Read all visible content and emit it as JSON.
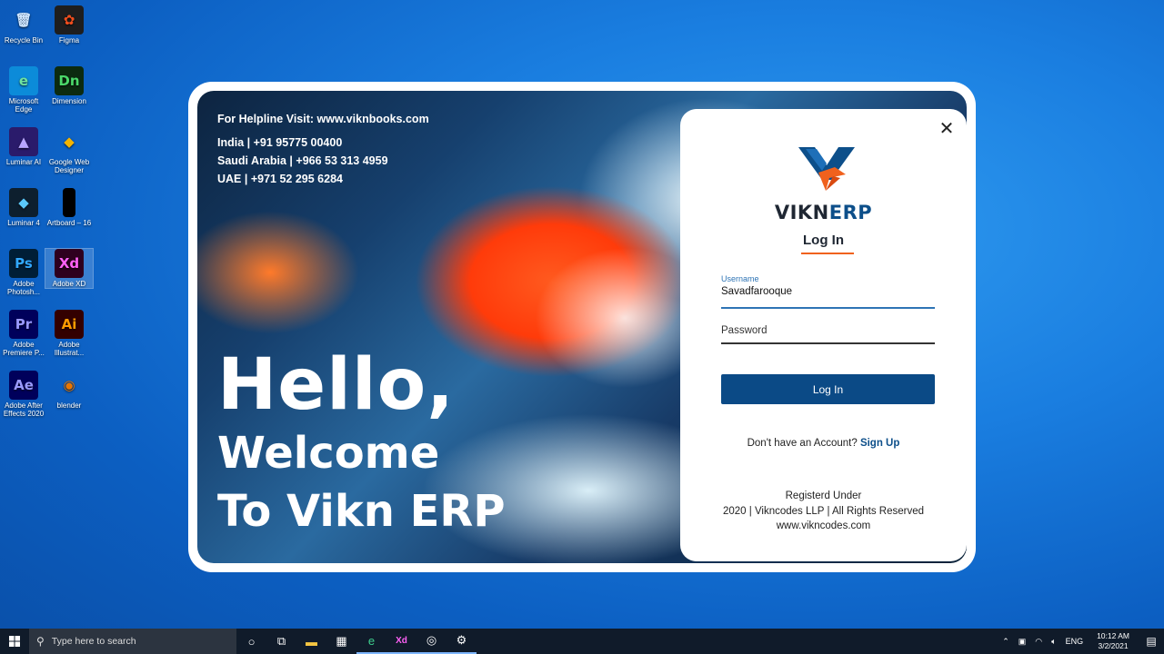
{
  "desktop": {
    "icons": [
      {
        "label": "Recycle Bin",
        "icon": "recycle-bin-icon",
        "glyph": "🗑",
        "bg": "transparent",
        "fg": "#cfe6ff"
      },
      {
        "label": "Figma",
        "icon": "figma-icon",
        "glyph": "✿",
        "bg": "#1e1e1e",
        "fg": "#f24e1e"
      },
      {
        "label": "Microsoft Edge",
        "icon": "edge-icon",
        "glyph": "e",
        "bg": "#0c8bd9",
        "fg": "#6fe3a0"
      },
      {
        "label": "Dimension",
        "icon": "dimension-icon",
        "glyph": "Dn",
        "bg": "#0c2b10",
        "fg": "#4bd96a"
      },
      {
        "label": "Luminar AI",
        "icon": "luminar-ai-icon",
        "glyph": "▲",
        "bg": "#2a1b6b",
        "fg": "#b8a6ff"
      },
      {
        "label": "Google Web Designer",
        "icon": "google-web-designer-icon",
        "glyph": "◆",
        "bg": "transparent",
        "fg": "#f4b400"
      },
      {
        "label": "Luminar 4",
        "icon": "luminar-4-icon",
        "glyph": "◆",
        "bg": "#0d1f2e",
        "fg": "#5ac8fa"
      },
      {
        "label": "Artboard – 16",
        "icon": "artboard-icon",
        "glyph": "",
        "bg": "#000000",
        "fg": "#000000"
      },
      {
        "label": "Adobe Photosh...",
        "icon": "photoshop-icon",
        "glyph": "Ps",
        "bg": "#001e36",
        "fg": "#31a8ff"
      },
      {
        "label": "Adobe XD",
        "icon": "adobe-xd-icon",
        "glyph": "Xd",
        "bg": "#2e001f",
        "fg": "#ff61f6"
      },
      {
        "label": "Adobe Premiere P...",
        "icon": "premiere-icon",
        "glyph": "Pr",
        "bg": "#00005b",
        "fg": "#9999ff"
      },
      {
        "label": "Adobe Illustrat...",
        "icon": "illustrator-icon",
        "glyph": "Ai",
        "bg": "#330000",
        "fg": "#ff9a00"
      },
      {
        "label": "Adobe After Effects 2020",
        "icon": "after-effects-icon",
        "glyph": "Ae",
        "bg": "#00005b",
        "fg": "#9999ff"
      },
      {
        "label": "blender",
        "icon": "blender-icon",
        "glyph": "◉",
        "bg": "transparent",
        "fg": "#ea7600"
      }
    ]
  },
  "hero": {
    "helpline": "For Helpline Visit: www.viknbooks.com",
    "india": "India | +91 95775 00400",
    "saudi": "Saudi Arabia | +966 53 313 4959",
    "uae": "UAE | +971 52 295 6284",
    "hello": "Hello,",
    "welcome": "Welcome",
    "to_vikn": "To Vikn ERP"
  },
  "login": {
    "brand_part1": "VIKN",
    "brand_part2": "ERP",
    "title": "Log In",
    "username_label": "Username",
    "username_value": "Savadfarooque",
    "password_placeholder": "Password",
    "login_button": "Log In",
    "no_account": "Don't have an Account?",
    "signup_link": "Sign Up",
    "footer_line1": "Registerd Under",
    "footer_line2": "2020 | Vikncodes LLP | All Rights Reserved",
    "footer_line3": "www.vikncodes.com",
    "close_glyph": "✕",
    "accent_color": "#f0611d",
    "primary_color": "#0b4a86"
  },
  "taskbar": {
    "search_placeholder": "Type here to search",
    "items": [
      {
        "icon": "cortana-icon",
        "glyph": "○"
      },
      {
        "icon": "task-view-icon",
        "glyph": "⧉"
      },
      {
        "icon": "file-explorer-icon",
        "glyph": "▬"
      },
      {
        "icon": "store-icon",
        "glyph": "▦"
      },
      {
        "icon": "edge-icon",
        "glyph": "e"
      },
      {
        "icon": "adobe-xd-icon",
        "glyph": "Xd"
      },
      {
        "icon": "app-icon",
        "glyph": "◎"
      },
      {
        "icon": "settings-icon",
        "glyph": "⚙"
      }
    ],
    "language": "ENG",
    "time": "10:12 AM",
    "date": "3/2/2021"
  }
}
